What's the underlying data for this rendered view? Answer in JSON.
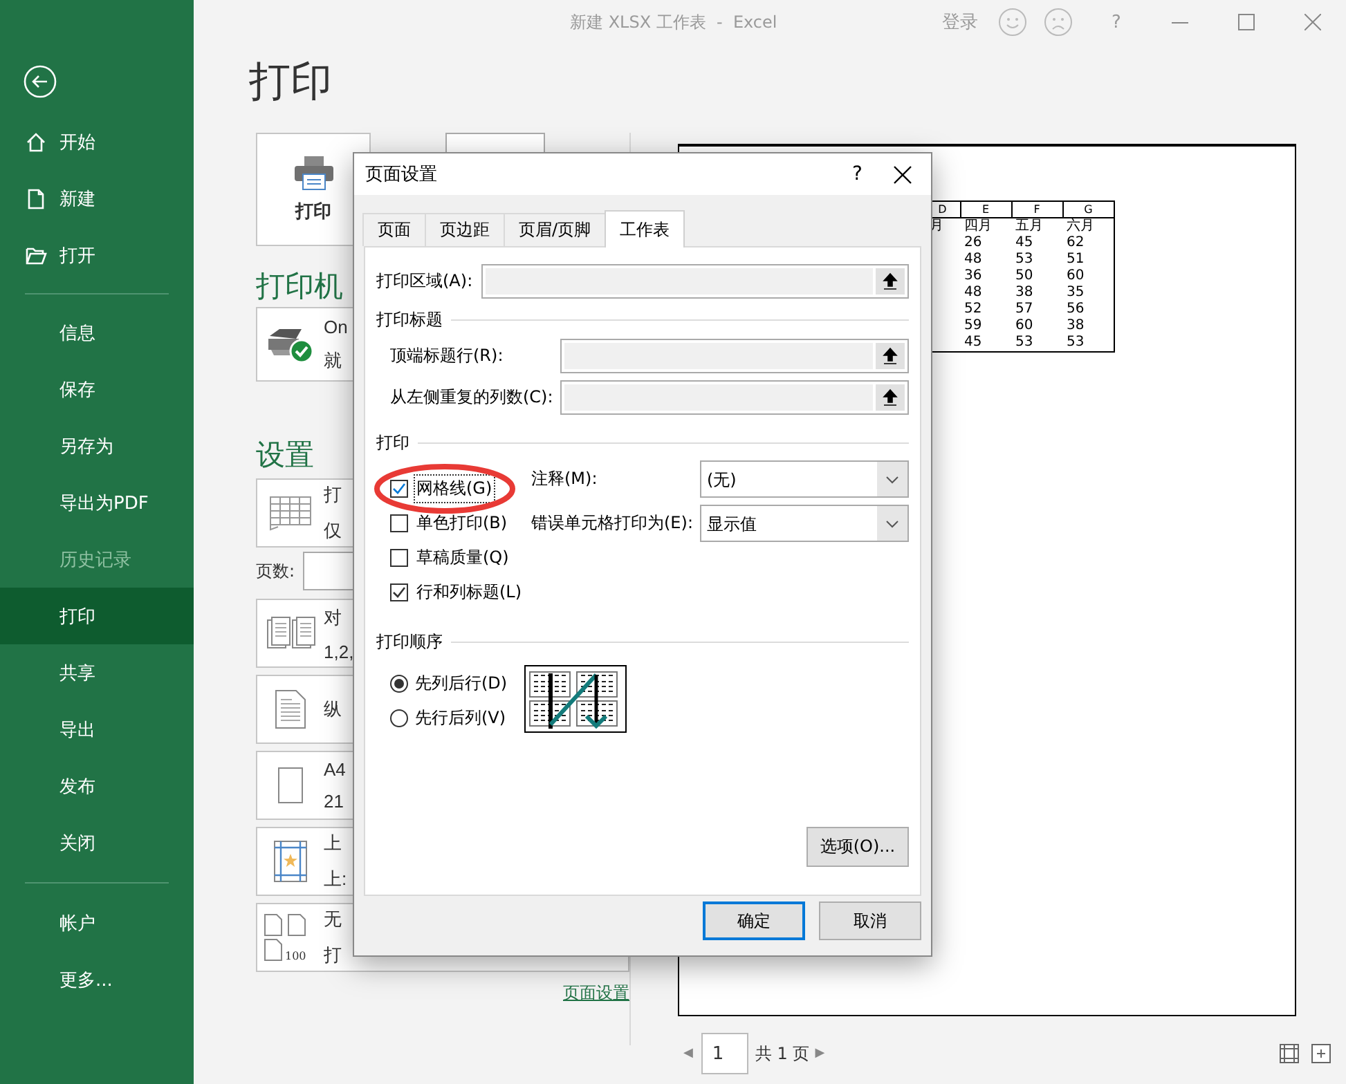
{
  "window": {
    "title": "新建 XLSX 工作表  -  Excel",
    "sign_in": "登录",
    "help": "?"
  },
  "sidebar": {
    "sections": [
      {
        "items": [
          {
            "label": "开始",
            "selected": false,
            "disabled": false
          },
          {
            "label": "新建",
            "selected": false,
            "disabled": false
          },
          {
            "label": "打开",
            "selected": false,
            "disabled": false
          }
        ]
      },
      {
        "items": [
          {
            "label": "信息",
            "selected": false,
            "disabled": false
          },
          {
            "label": "保存",
            "selected": false,
            "disabled": false
          },
          {
            "label": "另存为",
            "selected": false,
            "disabled": false
          },
          {
            "label": "导出为PDF",
            "selected": false,
            "disabled": false
          },
          {
            "label": "历史记录",
            "selected": false,
            "disabled": true
          },
          {
            "label": "打印",
            "selected": true,
            "disabled": false
          },
          {
            "label": "共享",
            "selected": false,
            "disabled": false
          },
          {
            "label": "导出",
            "selected": false,
            "disabled": false
          },
          {
            "label": "发布",
            "selected": false,
            "disabled": false
          },
          {
            "label": "关闭",
            "selected": false,
            "disabled": false
          }
        ]
      },
      {
        "items": [
          {
            "label": "帐户",
            "selected": false,
            "disabled": false
          },
          {
            "label": "更多...",
            "selected": false,
            "disabled": false
          }
        ]
      }
    ]
  },
  "page_title": "打印",
  "print_button": "打印",
  "printer": {
    "heading": "打印机",
    "name": "On",
    "status": "就"
  },
  "settings": {
    "heading": "设置",
    "pages_label": "页数:",
    "cards": [
      {
        "line1": "打",
        "line2": "仅"
      },
      {
        "line1": "对",
        "line2": "1,2,"
      },
      {
        "line1": "纵"
      },
      {
        "line1": "A4",
        "line2": "21"
      },
      {
        "line1": "上",
        "line2": "上:"
      },
      {
        "line1": "无",
        "line2": "打",
        "icon_label": "100"
      }
    ]
  },
  "page_setup_link": "页面设置",
  "preview": {
    "columns": [
      "D",
      "E",
      "F",
      "G"
    ],
    "rows": [
      [
        "月",
        "四月",
        "五月",
        "六月"
      ],
      [
        "",
        "26",
        "45",
        "62"
      ],
      [
        "",
        "48",
        "53",
        "51"
      ],
      [
        "",
        "36",
        "50",
        "60"
      ],
      [
        "",
        "48",
        "38",
        "35"
      ],
      [
        "",
        "52",
        "57",
        "56"
      ],
      [
        "",
        "59",
        "60",
        "38"
      ],
      [
        "",
        "45",
        "53",
        "53"
      ]
    ]
  },
  "pager": {
    "prev": "◀",
    "page": "1",
    "total": "共 1 页",
    "next": "▶"
  },
  "dialog": {
    "title": "页面设置",
    "help": "?",
    "tabs": [
      {
        "label": "页面",
        "selected": false
      },
      {
        "label": "页边距",
        "selected": false
      },
      {
        "label": "页眉/页脚",
        "selected": false
      },
      {
        "label": "工作表",
        "selected": true
      }
    ],
    "print_area": {
      "label": "打印区域(A):"
    },
    "titles_group": "打印标题",
    "title_fields": [
      {
        "label": "顶端标题行(R):"
      },
      {
        "label": "从左侧重复的列数(C):"
      }
    ],
    "print_group": "打印",
    "checkboxes": [
      {
        "label": "网格线(G)",
        "checked": true,
        "focused": true,
        "highlighted": true
      },
      {
        "label": "单色打印(B)",
        "checked": false,
        "focused": false,
        "highlighted": false
      },
      {
        "label": "草稿质量(Q)",
        "checked": false,
        "focused": false,
        "highlighted": false
      },
      {
        "label": "行和列标题(L)",
        "checked": true,
        "focused": false,
        "highlighted": false
      }
    ],
    "selects": [
      {
        "label": "注释(M):",
        "value": "(无)"
      },
      {
        "label": "错误单元格打印为(E):",
        "value": "显示值"
      }
    ],
    "order_group": "打印顺序",
    "radios": [
      {
        "label": "先列后行(D)",
        "selected": true
      },
      {
        "label": "先行后列(V)",
        "selected": false
      }
    ],
    "options_button": "选项(O)...",
    "ok_button": "确定",
    "cancel_button": "取消"
  }
}
